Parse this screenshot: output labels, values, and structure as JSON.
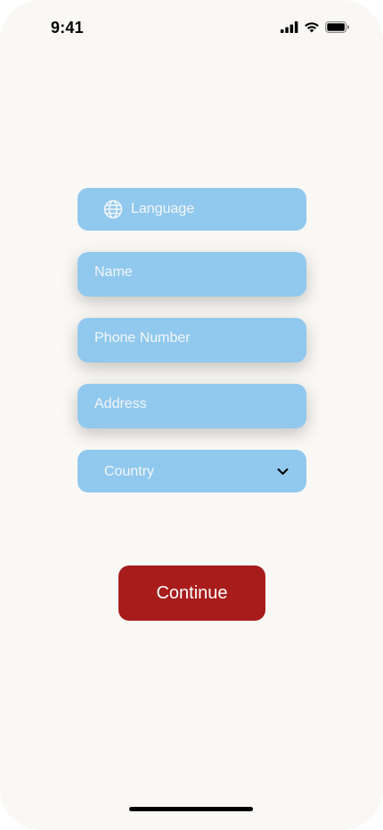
{
  "status_bar": {
    "time": "9:41",
    "icons": [
      "cellular-signal-icon",
      "wifi-icon",
      "battery-icon"
    ]
  },
  "form": {
    "language": {
      "label": "Language",
      "icon": "globe-icon"
    },
    "name": {
      "placeholder": "Name"
    },
    "phone": {
      "placeholder": "Phone Number"
    },
    "address": {
      "placeholder": "Address"
    },
    "country": {
      "value": "Country",
      "icon": "chevron-down-icon"
    }
  },
  "continue_button": {
    "label": "Continue"
  },
  "colors": {
    "background": "#faf8f5",
    "field": "#91c8ee",
    "button": "#a81c1c"
  }
}
